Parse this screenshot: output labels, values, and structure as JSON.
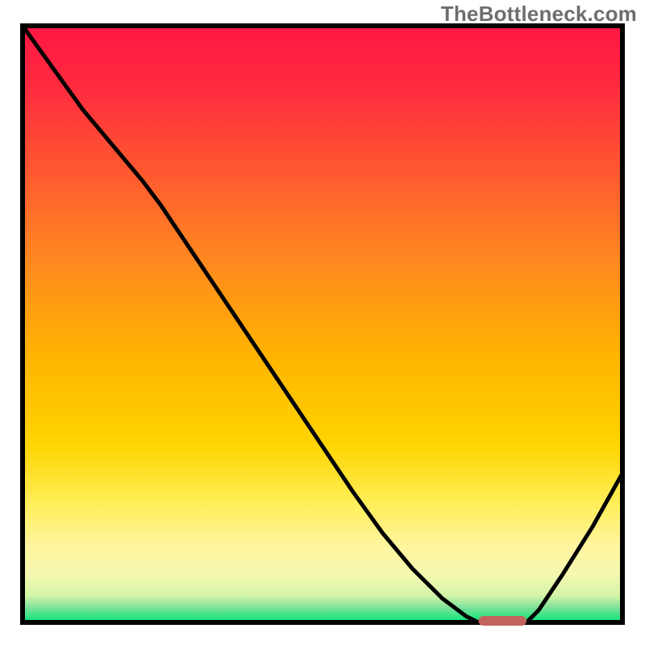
{
  "watermark": "TheBottleneck.com",
  "colors": {
    "frame": "#000000",
    "curve": "#000000",
    "marker": "#c1645f",
    "gradient_stops": [
      {
        "offset": 0.0,
        "color": "#ff1744"
      },
      {
        "offset": 0.1,
        "color": "#ff2a3f"
      },
      {
        "offset": 0.25,
        "color": "#ff5a2f"
      },
      {
        "offset": 0.4,
        "color": "#ff8a1f"
      },
      {
        "offset": 0.55,
        "color": "#ffb300"
      },
      {
        "offset": 0.7,
        "color": "#ffd400"
      },
      {
        "offset": 0.8,
        "color": "#ffee58"
      },
      {
        "offset": 0.87,
        "color": "#fff59d"
      },
      {
        "offset": 0.92,
        "color": "#f4f7b0"
      },
      {
        "offset": 0.955,
        "color": "#d4f5a8"
      },
      {
        "offset": 0.975,
        "color": "#7ee29b"
      },
      {
        "offset": 1.0,
        "color": "#00e676"
      }
    ]
  },
  "chart_data": {
    "type": "line",
    "title": "",
    "xlabel": "",
    "ylabel": "",
    "xlim": [
      0,
      100
    ],
    "ylim": [
      0,
      100
    ],
    "note": "Curve read from image pixels against a 0–100 × 0–100 frame. Values are estimates.",
    "curve": {
      "x": [
        0,
        5,
        10,
        15,
        20,
        23,
        25,
        30,
        35,
        40,
        45,
        50,
        55,
        60,
        65,
        70,
        74,
        76,
        80,
        84,
        86,
        90,
        95,
        100
      ],
      "y": [
        100,
        93,
        86,
        80,
        74,
        70,
        67,
        59.5,
        52,
        44.5,
        37,
        29.5,
        22,
        15,
        9,
        4,
        1,
        0,
        0,
        0,
        2,
        8,
        16,
        25
      ]
    },
    "marker": {
      "description": "rounded highlight bar on x-axis at curve minimum",
      "x_start": 76,
      "x_end": 84,
      "y": 0
    }
  }
}
